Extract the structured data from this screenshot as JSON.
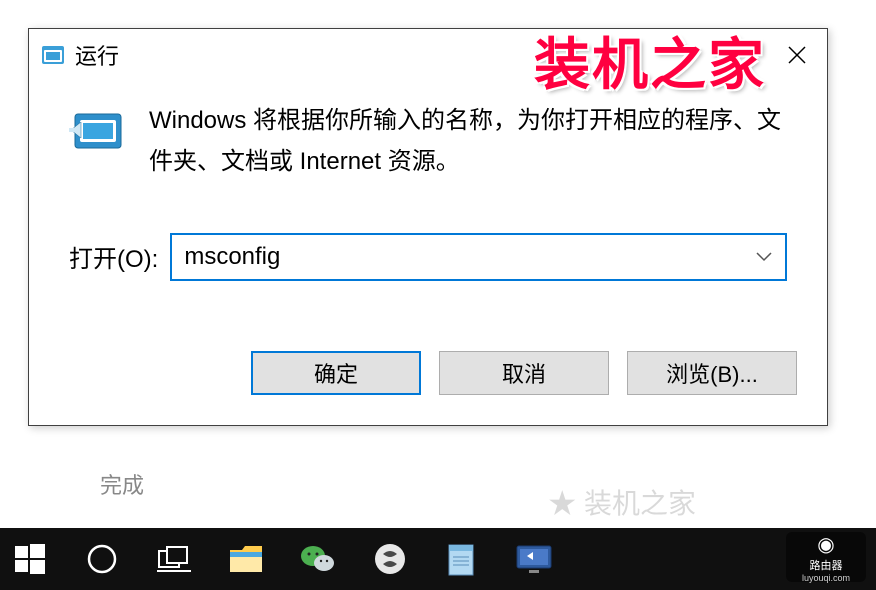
{
  "dialog": {
    "title": "运行",
    "description": "Windows 将根据你所输入的名称，为你打开相应的程序、文件夹、文档或 Internet 资源。",
    "open_label": "打开(O):",
    "input_value": "msconfig",
    "buttons": {
      "ok": "确定",
      "cancel": "取消",
      "browse": "浏览(B)..."
    }
  },
  "watermark": {
    "top": "装机之家",
    "bottom_label": "路由器",
    "bottom_url": "luyouqi.com"
  },
  "background": {
    "text": "完成"
  }
}
